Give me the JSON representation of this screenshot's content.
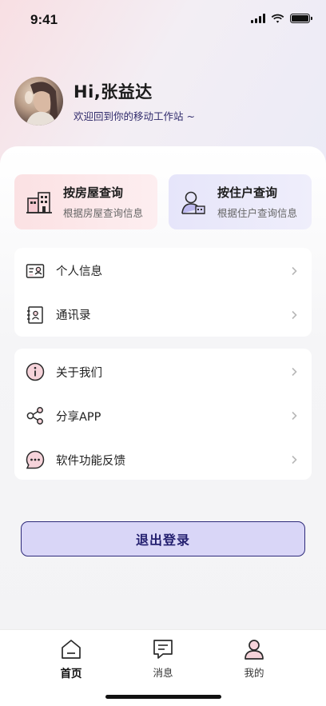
{
  "status_bar": {
    "time": "9:41"
  },
  "profile": {
    "greeting": "Hi,张益达",
    "subtitle": "欢迎回到你的移动工作站 ~",
    "avatar_icon": "user-photo"
  },
  "quick_actions": [
    {
      "title": "按房屋查询",
      "subtitle": "根据房屋查询信息",
      "icon": "building-icon"
    },
    {
      "title": "按住户查询",
      "subtitle": "根据住户查询信息",
      "icon": "resident-icon"
    }
  ],
  "menu_group_1": [
    {
      "label": "个人信息",
      "icon": "id-card-icon"
    },
    {
      "label": "通讯录",
      "icon": "contacts-icon"
    }
  ],
  "menu_group_2": [
    {
      "label": "关于我们",
      "icon": "info-icon"
    },
    {
      "label": "分享APP",
      "icon": "share-icon"
    },
    {
      "label": "软件功能反馈",
      "icon": "feedback-icon"
    }
  ],
  "logout_label": "退出登录",
  "tabs": [
    {
      "label": "首页",
      "icon": "home-icon",
      "active": true
    },
    {
      "label": "消息",
      "icon": "message-icon",
      "active": false
    },
    {
      "label": "我的",
      "icon": "profile-icon",
      "active": false
    }
  ],
  "colors": {
    "accent": "#2e2a7a",
    "logout_bg": "#d9d6f7",
    "house_card": "#fbe1e3",
    "resident_card": "#e6e5fa",
    "icon_pink": "#f6d3da"
  }
}
